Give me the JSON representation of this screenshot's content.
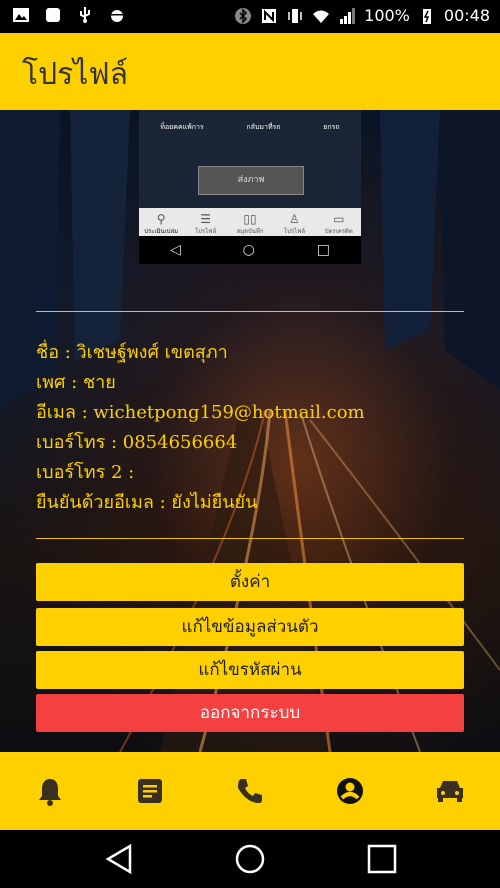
{
  "status_bar": {
    "battery": "100%",
    "time": "00:48"
  },
  "app_bar": {
    "title": "โปรไฟล์"
  },
  "preview": {
    "top_labels": [
      "ท็อยคคแพ้การ",
      "กลับมาที่รถ",
      "ยกรถ"
    ],
    "send_button": "ส่งภาพ",
    "tabs": [
      "ประเมินเปล่ม",
      "โปรไฟล์",
      "สมุดบันทึก",
      "โปรไฟล์",
      "บัตรเครดิต"
    ]
  },
  "profile": {
    "name": "ชื่อ : วิเชษฐ์พงศ์ เขตสุภา",
    "gender": "เพศ : ชาย",
    "email": "อีเมล : wichetpong159@hotmail.com",
    "phone": "เบอร์โทร : 0854656664",
    "phone2": "เบอร์โทร 2 :",
    "verify": "ยืนยันด้วยอีเมล : ยังไม่ยืนยัน"
  },
  "actions": {
    "settings": "ตั้งค่า",
    "edit_profile": "แก้ไขข้อมูลส่วนตัว",
    "change_password": "แก้ไขรหัสผ่าน",
    "logout": "ออกจากระบบ"
  },
  "bottom_nav": [
    "bell-icon",
    "notes-icon",
    "phone-icon",
    "account-icon",
    "car-icon"
  ],
  "colors": {
    "accent": "#ffd000",
    "logout": "#f44040",
    "text_on_dark": "#ffd000"
  }
}
